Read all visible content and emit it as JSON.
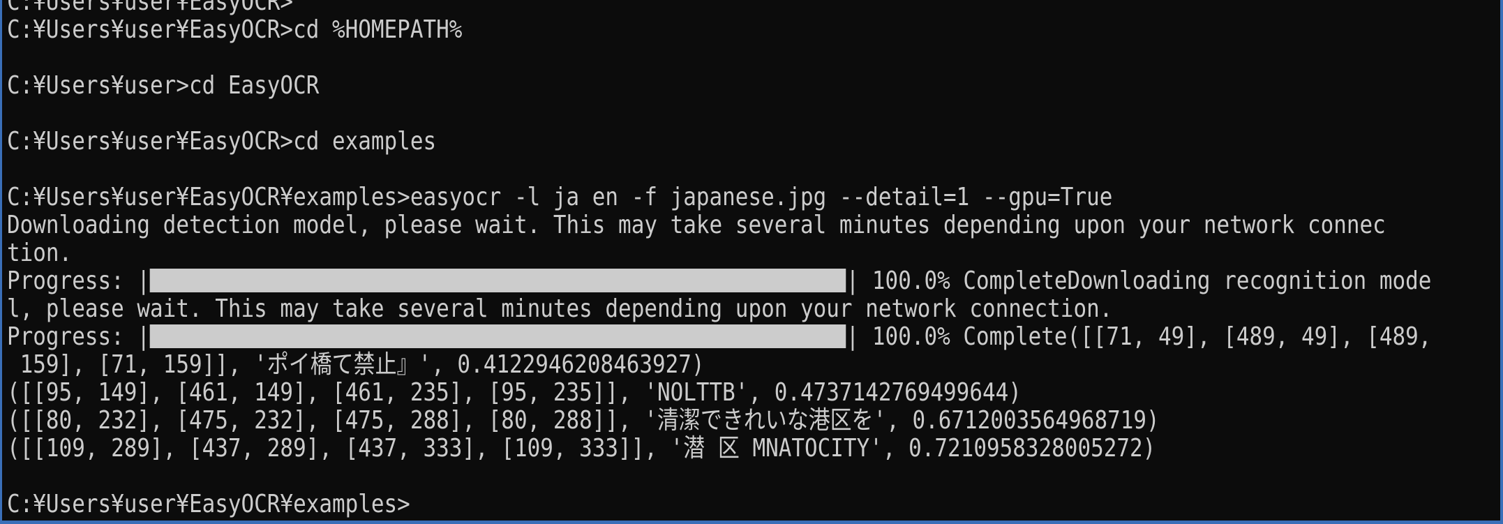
{
  "terminal": {
    "lines": [
      "C:¥Users¥user¥EasyOCR>",
      "C:¥Users¥user¥EasyOCR>cd %HOMEPATH%",
      "",
      "C:¥Users¥user>cd EasyOCR",
      "",
      "C:¥Users¥user¥EasyOCR>cd examples",
      "",
      "C:¥Users¥user¥EasyOCR¥examples>easyocr -l ja en -f japanese.jpg --detail=1 --gpu=True",
      "Downloading detection model, please wait. This may take several minutes depending upon your network connec",
      "tion.",
      "",
      "l, please wait. This may take several minutes depending upon your network connection.",
      "",
      " 159], [71, 159]], 'ポイ橋て禁止』', 0.4122946208463927)",
      "([[95, 149], [461, 149], [461, 235], [95, 235]], 'NOLTTB', 0.4737142769499644)",
      "([[80, 232], [475, 232], [475, 288], [80, 288]], '清潔できれいな港区を', 0.6712003564968719)",
      "([[109, 289], [437, 289], [437, 333], [109, 333]], '潜 区 MNATOCITY', 0.7210958328005272)",
      "",
      "C:¥Users¥user¥EasyOCR¥examples>"
    ],
    "progress1": {
      "prefix": "Progress: |",
      "suffix": "| 100.0% CompleteDownloading recognition mode",
      "percent": 100
    },
    "progress2": {
      "prefix": "Progress: |",
      "suffix": "| 100.0% Complete([[71, 49], [489, 49], [489,",
      "percent": 100
    }
  },
  "colors": {
    "background": "#0c0c0c",
    "foreground": "#cccccc",
    "window_border": "#3a6fb8"
  }
}
